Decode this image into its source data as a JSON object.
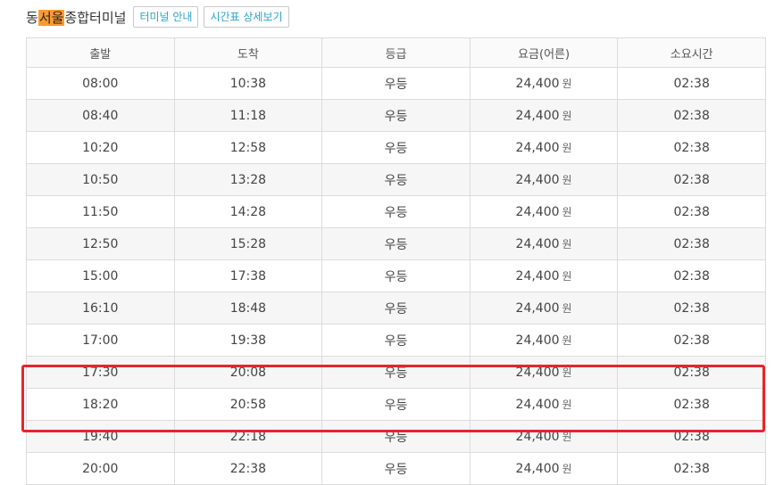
{
  "header": {
    "title_prefix": "동",
    "title_highlight": "서울",
    "title_suffix": "종합터미널",
    "buttons": [
      "터미널 안내",
      "시간표 상세보기"
    ]
  },
  "table": {
    "columns": [
      "출발",
      "도착",
      "등급",
      "요금(어른)",
      "소요시간"
    ],
    "currency": "원",
    "rows": [
      {
        "depart": "08:00",
        "arrive": "10:38",
        "grade": "우등",
        "fare": "24,400",
        "duration": "02:38"
      },
      {
        "depart": "08:40",
        "arrive": "11:18",
        "grade": "우등",
        "fare": "24,400",
        "duration": "02:38"
      },
      {
        "depart": "10:20",
        "arrive": "12:58",
        "grade": "우등",
        "fare": "24,400",
        "duration": "02:38"
      },
      {
        "depart": "10:50",
        "arrive": "13:28",
        "grade": "우등",
        "fare": "24,400",
        "duration": "02:38"
      },
      {
        "depart": "11:50",
        "arrive": "14:28",
        "grade": "우등",
        "fare": "24,400",
        "duration": "02:38"
      },
      {
        "depart": "12:50",
        "arrive": "15:28",
        "grade": "우등",
        "fare": "24,400",
        "duration": "02:38"
      },
      {
        "depart": "15:00",
        "arrive": "17:38",
        "grade": "우등",
        "fare": "24,400",
        "duration": "02:38"
      },
      {
        "depart": "16:10",
        "arrive": "18:48",
        "grade": "우등",
        "fare": "24,400",
        "duration": "02:38"
      },
      {
        "depart": "17:00",
        "arrive": "19:38",
        "grade": "우등",
        "fare": "24,400",
        "duration": "02:38"
      },
      {
        "depart": "17:30",
        "arrive": "20:08",
        "grade": "우등",
        "fare": "24,400",
        "duration": "02:38"
      },
      {
        "depart": "18:20",
        "arrive": "20:58",
        "grade": "우등",
        "fare": "24,400",
        "duration": "02:38"
      },
      {
        "depart": "19:40",
        "arrive": "22:18",
        "grade": "우등",
        "fare": "24,400",
        "duration": "02:38"
      },
      {
        "depart": "20:00",
        "arrive": "22:38",
        "grade": "우등",
        "fare": "24,400",
        "duration": "02:38"
      }
    ]
  },
  "colors": {
    "title_highlight": "#ff9a2e",
    "button_text": "#2aa3c8",
    "annotation_box": "#e8242c",
    "alt_row": "#f6f6f6"
  }
}
